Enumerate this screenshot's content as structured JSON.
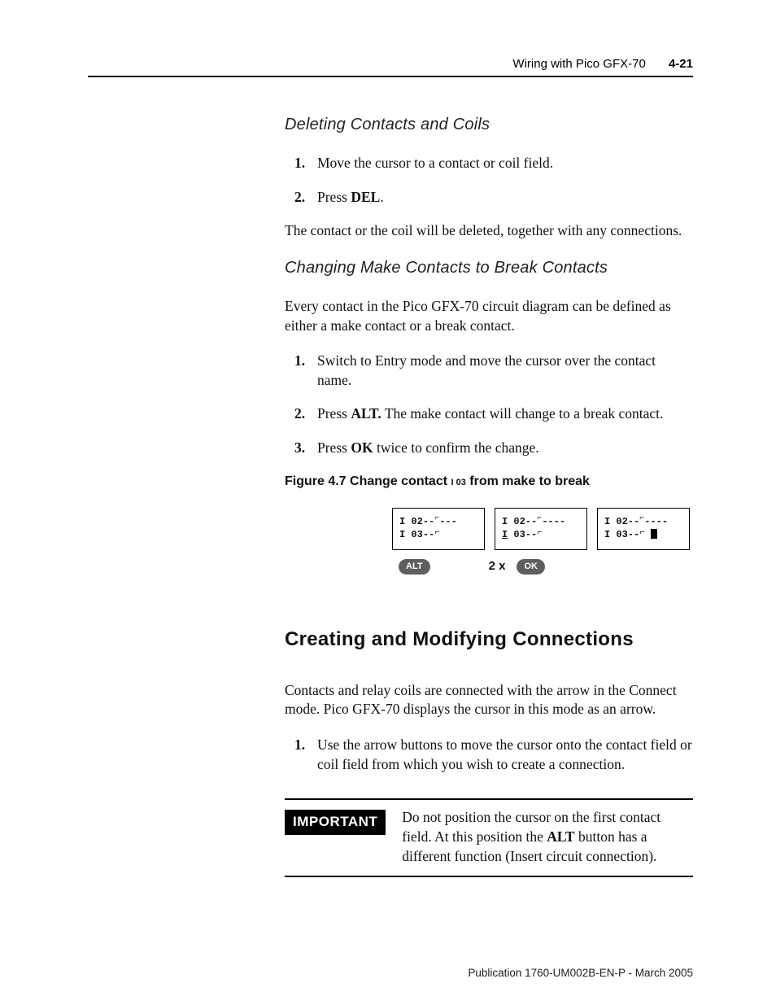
{
  "header": {
    "title": "Wiring with Pico GFX-70",
    "page_num": "4-21"
  },
  "sec1": {
    "heading": "Deleting Contacts and Coils",
    "step1": "Move the cursor to a contact or coil field.",
    "step2_pre": "Press ",
    "step2_bold": "DEL",
    "step2_post": ".",
    "after": "The contact or the coil will be deleted, together with any connections."
  },
  "sec2": {
    "heading": "Changing Make Contacts to Break Contacts",
    "intro": "Every contact in the Pico GFX-70 circuit diagram can be defined as either a make contact or a break contact.",
    "step1": "Switch to Entry mode and move the cursor over the contact name.",
    "step2_pre": "Press ",
    "step2_bold": "ALT.",
    "step2_post": " The make contact will change to a break contact.",
    "step3_pre": "Press ",
    "step3_bold": "OK",
    "step3_post": " twice to confirm the change."
  },
  "figure": {
    "caption_pre": "Figure 4.7 Change contact ",
    "caption_sub": "I 03",
    "caption_post": " from make to break",
    "screen1_l1a": "I 02--",
    "screen1_l1b": "---",
    "screen1_l2": "I 03--",
    "screen2_l1a": "I 02--",
    "screen2_l1b": "----",
    "screen2_l2a": "I",
    "screen2_l2b": " 03--",
    "screen3_l1a": "I 02--",
    "screen3_l1b": "----",
    "screen3_l2": "I 03--",
    "key_alt": "ALT",
    "key_2x": "2 x",
    "key_ok": "OK"
  },
  "sec3": {
    "heading": "Creating and Modifying Connections",
    "intro": "Contacts and relay coils are connected with the arrow in the Connect mode. Pico GFX-70 displays the cursor in this mode as an arrow.",
    "step1": "Use the arrow buttons to move the cursor onto the contact field or coil field from which you wish to create a connection."
  },
  "important": {
    "label": "IMPORTANT",
    "text_pre": "Do not position the cursor on the first contact field. At this position the ",
    "text_bold": "ALT",
    "text_post": " button has a different function (Insert circuit connection)."
  },
  "footer": {
    "text": "Publication 1760-UM002B-EN-P - March 2005"
  }
}
